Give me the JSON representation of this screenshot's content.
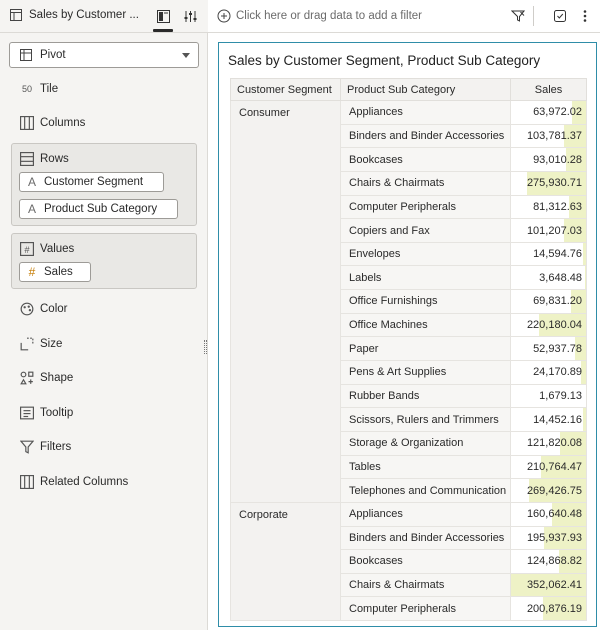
{
  "panel": {
    "title": "Sales by Customer ...",
    "viz_type": "Pivot",
    "grammar": {
      "tile": "Tile",
      "columns": "Columns",
      "rows": "Rows",
      "values": "Values",
      "color": "Color",
      "size": "Size",
      "shape": "Shape",
      "tooltip": "Tooltip",
      "filters": "Filters",
      "related_columns": "Related Columns"
    },
    "rows_items": [
      "Customer Segment",
      "Product Sub Category"
    ],
    "values_items": [
      "Sales"
    ]
  },
  "topbar": {
    "filter_placeholder": "Click here or drag data to add a filter"
  },
  "viz": {
    "title": "Sales by Customer Segment, Product Sub Category",
    "headers": [
      "Customer Segment",
      "Product Sub Category",
      "Sales"
    ],
    "bar_color": "#eef2c6",
    "bar_max": 352062.41,
    "groups": [
      {
        "segment": "Consumer",
        "rows": [
          {
            "sub": "Appliances",
            "sales": "63,972.02",
            "value": 63972.02
          },
          {
            "sub": "Binders and Binder Accessories",
            "sales": "103,781.37",
            "value": 103781.37
          },
          {
            "sub": "Bookcases",
            "sales": "93,010.28",
            "value": 93010.28
          },
          {
            "sub": "Chairs & Chairmats",
            "sales": "275,930.71",
            "value": 275930.71
          },
          {
            "sub": "Computer Peripherals",
            "sales": "81,312.63",
            "value": 81312.63
          },
          {
            "sub": "Copiers and Fax",
            "sales": "101,207.03",
            "value": 101207.03
          },
          {
            "sub": "Envelopes",
            "sales": "14,594.76",
            "value": 14594.76
          },
          {
            "sub": "Labels",
            "sales": "3,648.48",
            "value": 3648.48
          },
          {
            "sub": "Office Furnishings",
            "sales": "69,831.20",
            "value": 69831.2
          },
          {
            "sub": "Office Machines",
            "sales": "220,180.04",
            "value": 220180.04
          },
          {
            "sub": "Paper",
            "sales": "52,937.78",
            "value": 52937.78
          },
          {
            "sub": "Pens & Art Supplies",
            "sales": "24,170.89",
            "value": 24170.89
          },
          {
            "sub": "Rubber Bands",
            "sales": "1,679.13",
            "value": 1679.13
          },
          {
            "sub": "Scissors, Rulers and Trimmers",
            "sales": "14,452.16",
            "value": 14452.16
          },
          {
            "sub": "Storage & Organization",
            "sales": "121,820.08",
            "value": 121820.08
          },
          {
            "sub": "Tables",
            "sales": "210,764.47",
            "value": 210764.47
          },
          {
            "sub": "Telephones and Communication",
            "sales": "269,426.75",
            "value": 269426.75
          }
        ]
      },
      {
        "segment": "Corporate",
        "rows": [
          {
            "sub": "Appliances",
            "sales": "160,640.48",
            "value": 160640.48
          },
          {
            "sub": "Binders and Binder Accessories",
            "sales": "195,937.93",
            "value": 195937.93
          },
          {
            "sub": "Bookcases",
            "sales": "124,868.82",
            "value": 124868.82
          },
          {
            "sub": "Chairs & Chairmats",
            "sales": "352,062.41",
            "value": 352062.41
          },
          {
            "sub": "Computer Peripherals",
            "sales": "200,876.19",
            "value": 200876.19
          }
        ]
      }
    ]
  }
}
